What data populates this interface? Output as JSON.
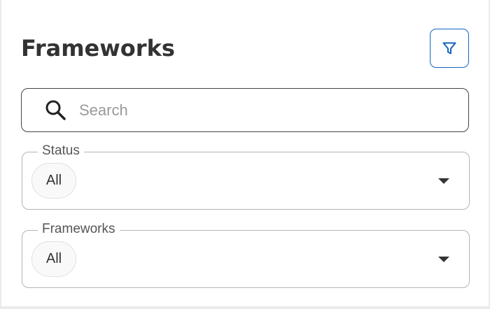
{
  "header": {
    "title": "Frameworks",
    "filter_icon": "filter-funnel-icon"
  },
  "search": {
    "placeholder": "Search",
    "value": "",
    "icon": "search-icon"
  },
  "filters": {
    "status": {
      "label": "Status",
      "selected": "All"
    },
    "frameworks": {
      "label": "Frameworks",
      "selected": "All"
    }
  },
  "colors": {
    "accent": "#1565c0",
    "title_text": "#333333",
    "border": "#b5b5b5"
  }
}
